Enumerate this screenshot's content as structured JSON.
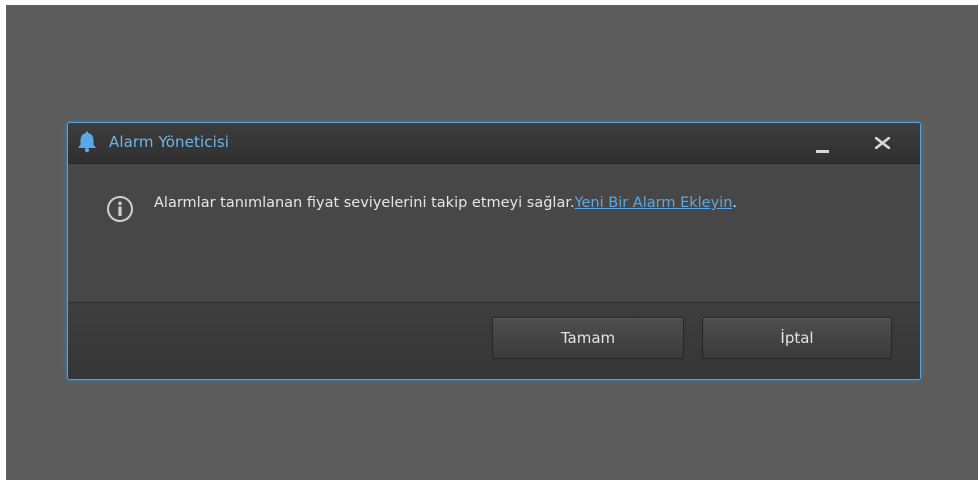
{
  "dialog": {
    "title": "Alarm Yöneticisi",
    "title_icon": "bell-icon",
    "minimize_icon": "minimize-icon",
    "close_icon": "close-icon",
    "message": {
      "info_icon": "info-icon",
      "text": "Alarmlar tanımlanan fiyat seviyelerini takip etmeyi sağlar.",
      "link_text": "Yeni Bir Alarm Ekleyin",
      "trailing": "."
    },
    "buttons": {
      "ok_label": "Tamam",
      "cancel_label": "İptal"
    }
  },
  "colors": {
    "accent": "#5aa4d8",
    "link": "#5aa9e8",
    "backdrop": "#5c5c5c",
    "dialog_bg": "#454545"
  }
}
